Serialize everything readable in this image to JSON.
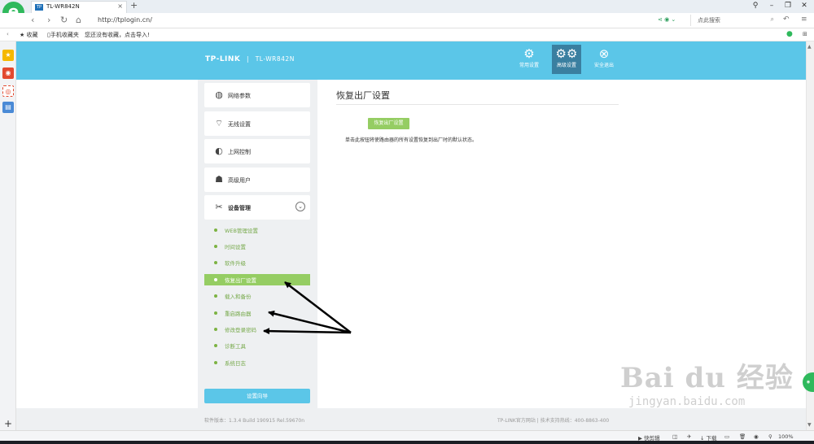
{
  "browser": {
    "logo": "e",
    "tab_title": "TL-WR842N",
    "tab_favicon": "TP",
    "tab_close": "×",
    "new_tab": "+",
    "url": "http://tplogin.cn/",
    "search_placeholder": "点此搜索",
    "win_controls": {
      "pin": "⚲",
      "minimize": "–",
      "restore": "❐",
      "close": "✕"
    }
  },
  "bookmarks": {
    "items": [
      "收藏",
      "手机收藏夹",
      "您还没有收藏，点击导入!"
    ]
  },
  "router": {
    "brand": "TP-LINK",
    "model": "TL-WR842N",
    "header_nav": [
      {
        "label": "常用设置",
        "icon": "gear-icon"
      },
      {
        "label": "高级设置",
        "icon": "gears-icon",
        "active": true
      },
      {
        "label": "安全退出",
        "icon": "exit-icon"
      }
    ],
    "menu": [
      {
        "label": "网络参数",
        "icon": "globe-icon"
      },
      {
        "label": "无线设置",
        "icon": "wifi-icon"
      },
      {
        "label": "上网控制",
        "icon": "internet-icon"
      },
      {
        "label": "高级用户",
        "icon": "user-icon"
      },
      {
        "label": "设备管理",
        "icon": "tools-icon",
        "expanded": true
      }
    ],
    "submenu": [
      {
        "label": "WEB管理设置"
      },
      {
        "label": "时间设置"
      },
      {
        "label": "软件升级"
      },
      {
        "label": "恢复出厂设置",
        "active": true
      },
      {
        "label": "载入和备份"
      },
      {
        "label": "重启路由器"
      },
      {
        "label": "修改登录密码"
      },
      {
        "label": "诊断工具"
      },
      {
        "label": "系统日志"
      }
    ],
    "wizard_button": "设置向导",
    "main": {
      "title": "恢复出厂设置",
      "reset_button": "恢复出厂设置",
      "description": "单击此按钮将使路由器的所有设置恢复到出厂时的默认状态。"
    },
    "footer": {
      "version": "软件版本：1.3.4 Build 190915 Rel.59670n",
      "site": "TP-LINK官方网站",
      "hotline": "技术支持热线：400-8863-400"
    }
  },
  "watermark": {
    "text": "Bai du 经验",
    "url": "jingyan.baidu.com"
  },
  "statusbar": {
    "quick_clip": "快剪辑",
    "download": "下载",
    "zoom": "100%"
  },
  "colors": {
    "header": "#5bc6e8",
    "accent_green": "#95cd63",
    "sidebar_bg": "#eef0f2",
    "arrow": "#000000"
  }
}
